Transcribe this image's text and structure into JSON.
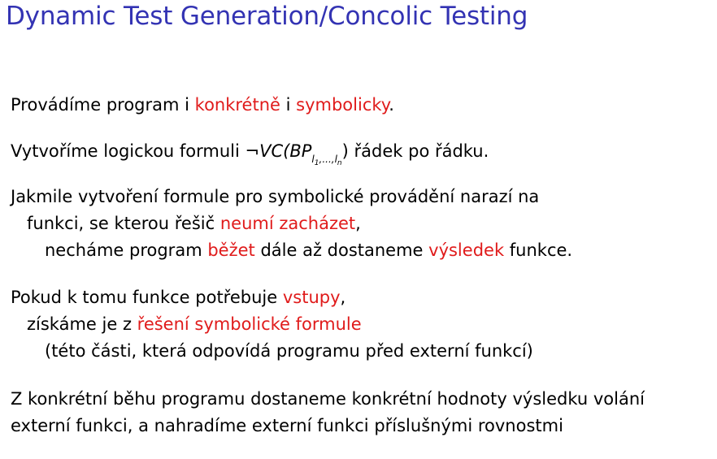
{
  "colors": {
    "title": "#3333b3",
    "highlight": "#e01b1b",
    "text": "#000000"
  },
  "slide": {
    "title": "Dynamic Test Generation/Concolic Testing",
    "p1": {
      "t1": "Provádíme program i ",
      "h1": "konkrétně",
      "t2": " i ",
      "h2": "symbolicky",
      "t3": "."
    },
    "p2": {
      "t1": "Vytvoříme logickou formuli ",
      "neg": "¬",
      "vc": "VC(BP",
      "sub_a": "l",
      "sub_a_idx": "1",
      "sub_mid": ",...,",
      "sub_b": "l",
      "sub_b_idx": "n",
      "close": ")",
      "t2": " řádek po řádku."
    },
    "p3": {
      "l1": "Jakmile vytvoření formule pro symbolické provádění narazí na",
      "l2_t1": "funkci, se kterou řešič ",
      "l2_h1": "neumí zacházet",
      "l2_t2": ",",
      "l3_t1": "necháme program ",
      "l3_h1": "běžet",
      "l3_t2": " dále až dostaneme ",
      "l3_h2": "výsledek",
      "l3_t3": " funkce."
    },
    "p4": {
      "l1_t1": "Pokud k tomu funkce potřebuje ",
      "l1_h1": "vstupy",
      "l1_t2": ",",
      "l2_t1": "získáme je z ",
      "l2_h1": "řešení symbolické formule",
      "l3": "(této části, která odpovídá programu před externí funkcí)"
    },
    "p5": {
      "l1": "Z konkrétní běhu programu dostaneme konkrétní hodnoty výsledku volání",
      "l2": "externí funkci, a nahradíme externí funkci příslušnými rovnostmi"
    }
  }
}
